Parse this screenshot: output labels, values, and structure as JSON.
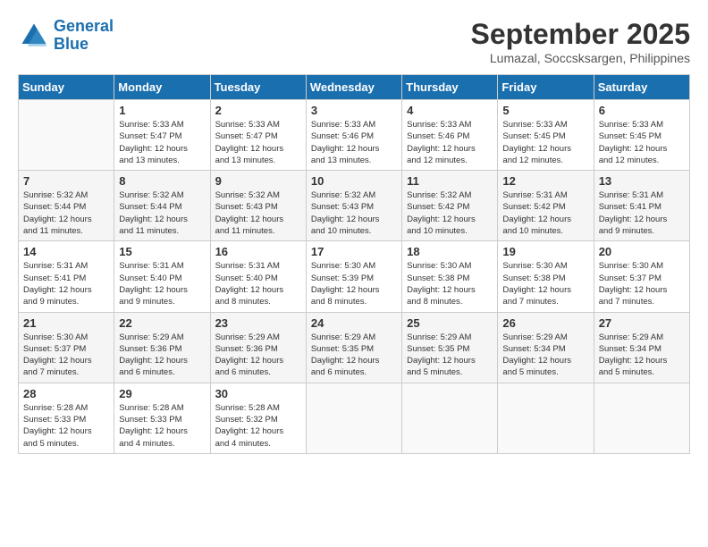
{
  "logo": {
    "line1": "General",
    "line2": "Blue"
  },
  "title": "September 2025",
  "location": "Lumazal, Soccsksargen, Philippines",
  "days_of_week": [
    "Sunday",
    "Monday",
    "Tuesday",
    "Wednesday",
    "Thursday",
    "Friday",
    "Saturday"
  ],
  "weeks": [
    [
      {
        "day": "",
        "info": ""
      },
      {
        "day": "1",
        "info": "Sunrise: 5:33 AM\nSunset: 5:47 PM\nDaylight: 12 hours\nand 13 minutes."
      },
      {
        "day": "2",
        "info": "Sunrise: 5:33 AM\nSunset: 5:47 PM\nDaylight: 12 hours\nand 13 minutes."
      },
      {
        "day": "3",
        "info": "Sunrise: 5:33 AM\nSunset: 5:46 PM\nDaylight: 12 hours\nand 13 minutes."
      },
      {
        "day": "4",
        "info": "Sunrise: 5:33 AM\nSunset: 5:46 PM\nDaylight: 12 hours\nand 12 minutes."
      },
      {
        "day": "5",
        "info": "Sunrise: 5:33 AM\nSunset: 5:45 PM\nDaylight: 12 hours\nand 12 minutes."
      },
      {
        "day": "6",
        "info": "Sunrise: 5:33 AM\nSunset: 5:45 PM\nDaylight: 12 hours\nand 12 minutes."
      }
    ],
    [
      {
        "day": "7",
        "info": "Sunrise: 5:32 AM\nSunset: 5:44 PM\nDaylight: 12 hours\nand 11 minutes."
      },
      {
        "day": "8",
        "info": "Sunrise: 5:32 AM\nSunset: 5:44 PM\nDaylight: 12 hours\nand 11 minutes."
      },
      {
        "day": "9",
        "info": "Sunrise: 5:32 AM\nSunset: 5:43 PM\nDaylight: 12 hours\nand 11 minutes."
      },
      {
        "day": "10",
        "info": "Sunrise: 5:32 AM\nSunset: 5:43 PM\nDaylight: 12 hours\nand 10 minutes."
      },
      {
        "day": "11",
        "info": "Sunrise: 5:32 AM\nSunset: 5:42 PM\nDaylight: 12 hours\nand 10 minutes."
      },
      {
        "day": "12",
        "info": "Sunrise: 5:31 AM\nSunset: 5:42 PM\nDaylight: 12 hours\nand 10 minutes."
      },
      {
        "day": "13",
        "info": "Sunrise: 5:31 AM\nSunset: 5:41 PM\nDaylight: 12 hours\nand 9 minutes."
      }
    ],
    [
      {
        "day": "14",
        "info": "Sunrise: 5:31 AM\nSunset: 5:41 PM\nDaylight: 12 hours\nand 9 minutes."
      },
      {
        "day": "15",
        "info": "Sunrise: 5:31 AM\nSunset: 5:40 PM\nDaylight: 12 hours\nand 9 minutes."
      },
      {
        "day": "16",
        "info": "Sunrise: 5:31 AM\nSunset: 5:40 PM\nDaylight: 12 hours\nand 8 minutes."
      },
      {
        "day": "17",
        "info": "Sunrise: 5:30 AM\nSunset: 5:39 PM\nDaylight: 12 hours\nand 8 minutes."
      },
      {
        "day": "18",
        "info": "Sunrise: 5:30 AM\nSunset: 5:38 PM\nDaylight: 12 hours\nand 8 minutes."
      },
      {
        "day": "19",
        "info": "Sunrise: 5:30 AM\nSunset: 5:38 PM\nDaylight: 12 hours\nand 7 minutes."
      },
      {
        "day": "20",
        "info": "Sunrise: 5:30 AM\nSunset: 5:37 PM\nDaylight: 12 hours\nand 7 minutes."
      }
    ],
    [
      {
        "day": "21",
        "info": "Sunrise: 5:30 AM\nSunset: 5:37 PM\nDaylight: 12 hours\nand 7 minutes."
      },
      {
        "day": "22",
        "info": "Sunrise: 5:29 AM\nSunset: 5:36 PM\nDaylight: 12 hours\nand 6 minutes."
      },
      {
        "day": "23",
        "info": "Sunrise: 5:29 AM\nSunset: 5:36 PM\nDaylight: 12 hours\nand 6 minutes."
      },
      {
        "day": "24",
        "info": "Sunrise: 5:29 AM\nSunset: 5:35 PM\nDaylight: 12 hours\nand 6 minutes."
      },
      {
        "day": "25",
        "info": "Sunrise: 5:29 AM\nSunset: 5:35 PM\nDaylight: 12 hours\nand 5 minutes."
      },
      {
        "day": "26",
        "info": "Sunrise: 5:29 AM\nSunset: 5:34 PM\nDaylight: 12 hours\nand 5 minutes."
      },
      {
        "day": "27",
        "info": "Sunrise: 5:29 AM\nSunset: 5:34 PM\nDaylight: 12 hours\nand 5 minutes."
      }
    ],
    [
      {
        "day": "28",
        "info": "Sunrise: 5:28 AM\nSunset: 5:33 PM\nDaylight: 12 hours\nand 5 minutes."
      },
      {
        "day": "29",
        "info": "Sunrise: 5:28 AM\nSunset: 5:33 PM\nDaylight: 12 hours\nand 4 minutes."
      },
      {
        "day": "30",
        "info": "Sunrise: 5:28 AM\nSunset: 5:32 PM\nDaylight: 12 hours\nand 4 minutes."
      },
      {
        "day": "",
        "info": ""
      },
      {
        "day": "",
        "info": ""
      },
      {
        "day": "",
        "info": ""
      },
      {
        "day": "",
        "info": ""
      }
    ]
  ]
}
